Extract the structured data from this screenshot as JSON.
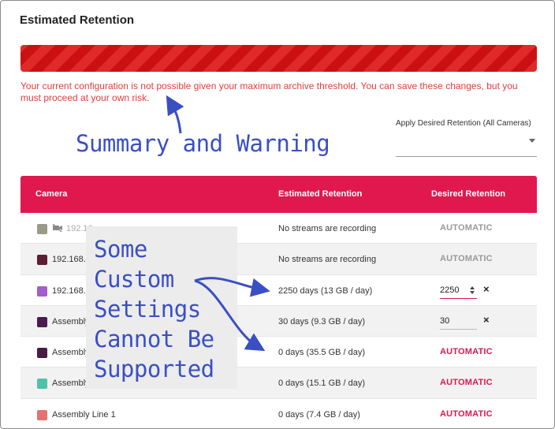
{
  "page": {
    "title": "Estimated Retention",
    "warning_text": "Your current configuration is not possible given your maximum archive threshold. You can save these changes, but you must proceed at your own risk.",
    "apply_label": "Apply Desired Retention (All Cameras)",
    "apply_value": ""
  },
  "table": {
    "headers": {
      "camera": "Camera",
      "estimated": "Estimated Retention",
      "desired": "Desired Retention"
    },
    "rows": [
      {
        "camera": "192.16",
        "swatch": "#9a9b86",
        "estimated": "No streams are recording",
        "desired": "AUTOMATIC"
      },
      {
        "camera": "192.168.2",
        "swatch": "#5e1f35",
        "estimated": "No streams are recording",
        "desired": "AUTOMATIC"
      },
      {
        "camera": "192.168.2",
        "swatch": "#a35fc9",
        "estimated": "2250 days (13 GB / day)",
        "desired": "2250"
      },
      {
        "camera": "Assembly",
        "swatch": "#4d1a4f",
        "estimated": "30 days (9.3 GB / day)",
        "desired": "30"
      },
      {
        "camera": "Assembly",
        "swatch": "#4a1c45",
        "estimated": "0 days (35.5 GB / day)",
        "desired": "AUTOMATIC"
      },
      {
        "camera": "Assembly",
        "swatch": "#4fc1a6",
        "estimated": "0 days (15.1 GB / day)",
        "desired": "AUTOMATIC"
      },
      {
        "camera": "Assembly Line 1",
        "swatch": "#e5726f",
        "estimated": "0 days (7.4 GB / day)",
        "desired": "AUTOMATIC"
      }
    ]
  },
  "annotations": {
    "summary_caption": "Summary and Warning",
    "callout_lines": [
      "Some",
      "Custom",
      "Settings",
      "Cannot Be",
      "Supported"
    ]
  },
  "colors": {
    "accent": "#e0184e",
    "warning": "#e33d3d",
    "annotation": "#3a4fc4"
  },
  "icons": {
    "clear": "×",
    "camera_disabled": "camera-off-icon"
  }
}
